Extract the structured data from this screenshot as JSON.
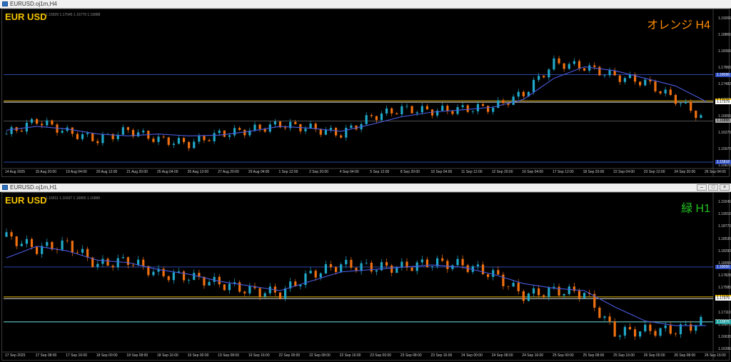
{
  "windows": [
    {
      "title": "EURUSD.oj1m,H4",
      "symbol": "EUR USD",
      "ohlc": "1.16929 1.17045 1.16779 1.16888",
      "tag": "オレンジ H4",
      "tag_color": "#ff8c00",
      "y_labels": [
        "1.19265",
        "1.18865",
        "1.18365",
        "1.17860",
        "1.17482",
        "1.17155",
        "1.16655",
        "1.16270",
        "1.15970",
        "1.15670"
      ],
      "x_labels": [
        "14 Aug 2025",
        "15 Aug 20:00",
        "19 Aug 04:00",
        "20 Aug 12:00",
        "21 Aug 20:00",
        "25 Aug 04:00",
        "26 Aug 12:00",
        "27 Aug 20:00",
        "29 Aug 04:00",
        "1 Sep 12:00",
        "2 Sep 20:00",
        "4 Sep 04:00",
        "5 Sep 12:00",
        "8 Sep 20:00",
        "10 Sep 04:00",
        "11 Sep 12:00",
        "12 Sep 20:00",
        "16 Sep 04:00",
        "17 Sep 12:00",
        "18 Sep 20:00",
        "22 Sep 04:00",
        "23 Sep 12:00",
        "24 Sep 20:00",
        "26 Sep 04:00"
      ],
      "price_boxes": [
        {
          "label": "1.18096",
          "color": "#3050c0"
        },
        {
          "label": "1.17415",
          "color": "#f5c400"
        },
        {
          "label": "1.17379",
          "color": "#ffffff"
        },
        {
          "label": "1.16888",
          "color": "#a0a0a0"
        },
        {
          "label": "1.15818",
          "color": "#3050c0"
        }
      ]
    },
    {
      "title": "EURUSD.oj1m,H1",
      "symbol": "EUR USD",
      "ohlc": "1.16911 1.16937 1.16865 1.16888",
      "tag": "緑 H1",
      "tag_color": "#22c022",
      "y_labels": [
        "1.19245",
        "1.19010",
        "1.18770",
        "1.18535",
        "1.18290",
        "1.18055",
        "1.17828",
        "1.17585",
        "1.17345",
        "1.17110",
        "1.16875",
        "1.16630",
        "1.16395"
      ],
      "x_labels": [
        "17 Sep 2025",
        "17 Sep 08:00",
        "17 Sep 16:00",
        "18 Sep 00:00",
        "18 Sep 08:00",
        "18 Sep 16:00",
        "19 Sep 00:00",
        "19 Sep 08:00",
        "19 Sep 16:00",
        "22 Sep 00:00",
        "22 Sep 08:00",
        "22 Sep 16:00",
        "23 Sep 00:00",
        "23 Sep 08:00",
        "23 Sep 16:00",
        "24 Sep 00:00",
        "24 Sep 08:00",
        "24 Sep 16:00",
        "25 Sep 00:00",
        "25 Sep 08:00",
        "25 Sep 16:00",
        "26 Sep 00:00",
        "26 Sep 08:00",
        "26 Sep 16:00"
      ],
      "price_boxes": [
        {
          "label": "1.18056",
          "color": "#3050c0"
        },
        {
          "label": "1.17415",
          "color": "#f5c400"
        },
        {
          "label": "1.17379",
          "color": "#ffffff"
        },
        {
          "label": "1.16888",
          "color": "#a0a0a0"
        },
        {
          "label": "1.16876",
          "color": "#20a0a0"
        }
      ]
    }
  ],
  "chart_data": [
    {
      "type": "line",
      "title": "",
      "xlabel": "",
      "ylabel": "",
      "ylim": [
        1.1567,
        1.195
      ],
      "x": [
        "14 Aug 2025",
        "15 Aug 20:00",
        "19 Aug 04:00",
        "20 Aug 12:00",
        "21 Aug 20:00",
        "25 Aug 04:00",
        "26 Aug 12:00",
        "27 Aug 20:00",
        "29 Aug 04:00",
        "1 Sep 12:00",
        "2 Sep 20:00",
        "4 Sep 04:00",
        "5 Sep 12:00",
        "8 Sep 20:00",
        "10 Sep 04:00",
        "11 Sep 12:00",
        "12 Sep 20:00",
        "16 Sep 04:00",
        "17 Sep 12:00",
        "18 Sep 20:00",
        "22 Sep 04:00",
        "23 Sep 12:00",
        "24 Sep 20:00",
        "26 Sep 04:00"
      ],
      "series": [
        {
          "values": [
            1.1655,
            1.169,
            1.166,
            1.164,
            1.1665,
            1.164,
            1.163,
            1.1655,
            1.1665,
            1.168,
            1.167,
            1.1655,
            1.17,
            1.172,
            1.1715,
            1.172,
            1.1725,
            1.176,
            1.184,
            1.183,
            1.1805,
            1.179,
            1.1745,
            1.169
          ],
          "color": "#f07010"
        },
        {
          "values": [
            1.1665,
            1.1675,
            1.1668,
            1.1655,
            1.165,
            1.1655,
            1.165,
            1.1652,
            1.1662,
            1.1675,
            1.167,
            1.1662,
            1.168,
            1.17,
            1.1712,
            1.1718,
            1.1725,
            1.1745,
            1.18,
            1.183,
            1.182,
            1.18,
            1.178,
            1.174
          ],
          "color": "#4a5ae0"
        }
      ],
      "hlines": [
        1.18096,
        1.17415,
        1.17379,
        1.16888,
        1.15818
      ]
    },
    {
      "type": "line",
      "title": "",
      "xlabel": "",
      "ylabel": "",
      "ylim": [
        1.1625,
        1.194
      ],
      "x": [
        "17 Sep 2025",
        "17 Sep 08:00",
        "17 Sep 16:00",
        "18 Sep 00:00",
        "18 Sep 08:00",
        "18 Sep 16:00",
        "19 Sep 00:00",
        "19 Sep 08:00",
        "19 Sep 16:00",
        "22 Sep 00:00",
        "22 Sep 08:00",
        "22 Sep 16:00",
        "23 Sep 00:00",
        "23 Sep 08:00",
        "23 Sep 16:00",
        "24 Sep 00:00",
        "24 Sep 08:00",
        "24 Sep 16:00",
        "25 Sep 00:00",
        "25 Sep 08:00",
        "25 Sep 16:00",
        "26 Sep 00:00",
        "26 Sep 08:00",
        "26 Sep 16:00"
      ],
      "series": [
        {
          "values": [
            1.187,
            1.1845,
            1.1855,
            1.181,
            1.182,
            1.179,
            1.1785,
            1.177,
            1.1755,
            1.175,
            1.179,
            1.181,
            1.1805,
            1.1805,
            1.1815,
            1.181,
            1.179,
            1.1745,
            1.1755,
            1.175,
            1.1665,
            1.167,
            1.167,
            1.169
          ],
          "color": "#f07010"
        },
        {
          "values": [
            1.1825,
            1.185,
            1.184,
            1.182,
            1.1815,
            1.18,
            1.179,
            1.1775,
            1.1765,
            1.1755,
            1.1775,
            1.1795,
            1.18,
            1.1805,
            1.181,
            1.1805,
            1.179,
            1.177,
            1.176,
            1.1755,
            1.172,
            1.169,
            1.168,
            1.168
          ],
          "color": "#4a5ae0"
        }
      ],
      "hlines": [
        1.18056,
        1.17415,
        1.17379,
        1.16888,
        1.16876
      ]
    }
  ],
  "colors": {
    "bull": "#20a8c8",
    "bear": "#f07010",
    "ma": "#4a5ae0",
    "grid": "#3a3a3a"
  }
}
